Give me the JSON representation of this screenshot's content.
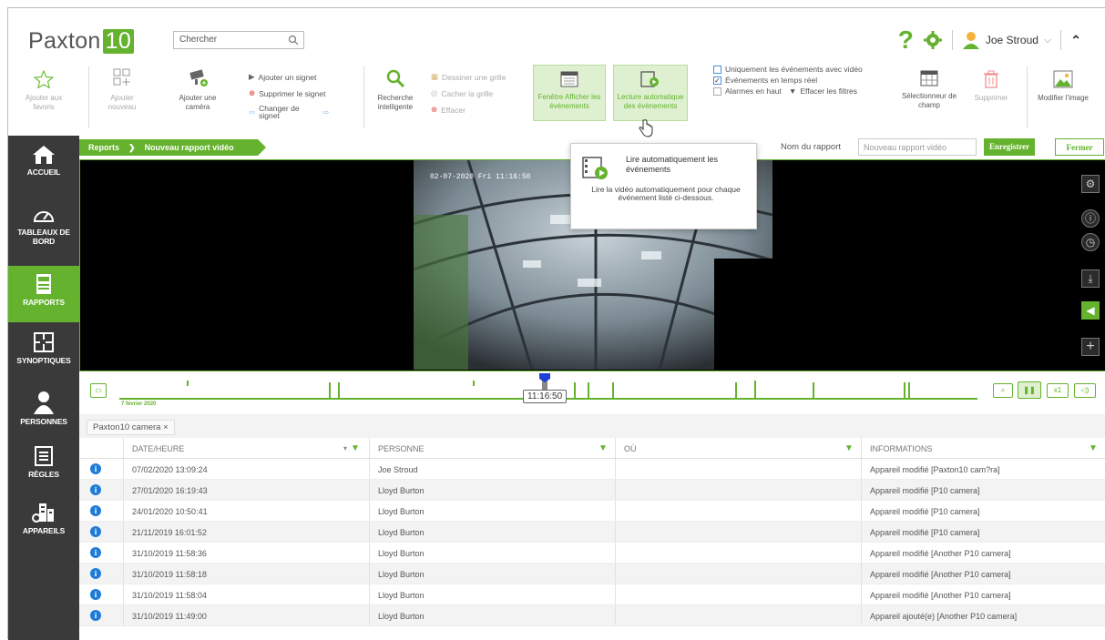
{
  "app": {
    "logo_text": "Paxton",
    "logo_number": "10"
  },
  "search": {
    "placeholder": "Chercher"
  },
  "user": {
    "name": "Joe Stroud"
  },
  "colors": {
    "accent": "#64b22e",
    "sidebar": "#3a3a3a",
    "info": "#1f7cd6"
  },
  "ribbon": {
    "add_fav": "Ajouter aux favoris",
    "add_new": "Ajouter nouveau",
    "add_camera": "Ajouter une caméra",
    "add_bookmark": "Ajouter un signet",
    "delete_bookmark": "Supprimer le signet",
    "change_bookmark": "Changer de signet",
    "smart_search": "Recherche intelligente",
    "draw_grid": "Dessiner une grille",
    "hide_grid": "Cacher la grille",
    "clear": "Effacer",
    "show_events": "Fenêtre Afficher les événements",
    "autoplay": "Lecture automatique des événements",
    "only_video": "Uniquement les événements avec vidéo",
    "realtime": "Événements en temps réel",
    "alarms_top": "Alarmes en haut",
    "clear_filters": "Effacer les filtres",
    "field_selector": "Sélectionneur de champ",
    "delete": "Supprimer",
    "edit_image": "Modifier l'image"
  },
  "nav": [
    {
      "label": "ACCUEIL",
      "icon": "home-icon"
    },
    {
      "label": "TABLEAUX DE BORD",
      "icon": "dashboard-icon"
    },
    {
      "label": "RAPPORTS",
      "icon": "reports-icon"
    },
    {
      "label": "SYNOPTIQUES",
      "icon": "floorplan-icon"
    },
    {
      "label": "PERSONNES",
      "icon": "person-icon"
    },
    {
      "label": "RÈGLES",
      "icon": "rules-icon"
    },
    {
      "label": "APPAREILS",
      "icon": "devices-icon"
    }
  ],
  "breadcrumb": {
    "root": "Reports",
    "current": "Nouveau rapport vidéo"
  },
  "report": {
    "name_label": "Nom du rapport",
    "name_placeholder": "Nouveau rapport vidéo",
    "save": "Enregistrer",
    "close": "Fermer"
  },
  "video": {
    "overlay": "02-07-2020 Fri 11:16:50"
  },
  "timeline": {
    "time": "11:16:50",
    "date": "7 février 2020",
    "speed": "x1"
  },
  "tooltip": {
    "title": "Lire automatiquement les événements",
    "body": "Lire la vidéo automatiquement pour chaque événement listé ci-dessous."
  },
  "tab": {
    "label": "Paxton10 camera",
    "close": "×"
  },
  "table": {
    "headers": [
      "DATE/HEURE",
      "PERSONNE",
      "OÙ",
      "INFORMATIONS"
    ],
    "rows": [
      [
        "07/02/2020 13:09:24",
        "Joe Stroud",
        "",
        "Appareil modifié [Paxton10 cam?ra]"
      ],
      [
        "27/01/2020 16:19:43",
        "Lloyd Burton",
        "",
        "Appareil modifié [P10 camera]"
      ],
      [
        "24/01/2020 10:50:41",
        "Lloyd Burton",
        "",
        "Appareil modifié [P10 camera]"
      ],
      [
        "21/11/2019 16:01:52",
        "Lloyd Burton",
        "",
        "Appareil modifié [P10 camera]"
      ],
      [
        "31/10/2019 11:58:36",
        "Lloyd Burton",
        "",
        "Appareil modifié [Another P10 camera]"
      ],
      [
        "31/10/2019 11:58:18",
        "Lloyd Burton",
        "",
        "Appareil modifié [Another P10 camera]"
      ],
      [
        "31/10/2019 11:58:04",
        "Lloyd Burton",
        "",
        "Appareil modifié [Another P10 camera]"
      ],
      [
        "31/10/2019 11:49:00",
        "Lloyd Burton",
        "",
        "Appareil ajouté(e) [Another P10 camera]"
      ]
    ]
  }
}
